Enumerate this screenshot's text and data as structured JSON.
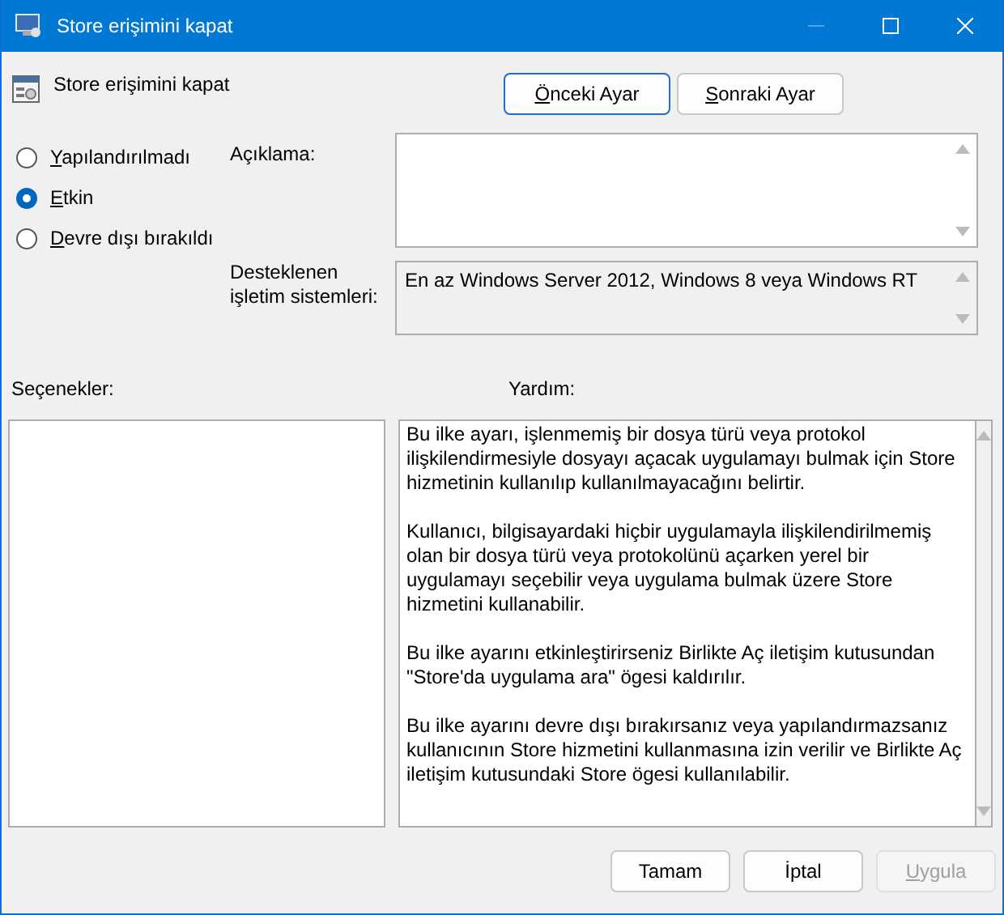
{
  "window": {
    "title": "Store erişimini kapat",
    "controls": [
      {
        "kind": "minimize",
        "disabled": true
      },
      {
        "kind": "maximize",
        "disabled": false
      },
      {
        "kind": "close",
        "disabled": false
      }
    ]
  },
  "header": {
    "title": "Store erişimini kapat"
  },
  "nav_buttons": [
    {
      "label": "Önceki Ayar",
      "underline_first": true,
      "focused": true
    },
    {
      "label": "Sonraki Ayar",
      "underline_first": true,
      "focused": false
    }
  ],
  "states": [
    {
      "label": "Yapılandırılmadı",
      "underline_first": true,
      "selected": false
    },
    {
      "label": "Etkin",
      "underline_first": true,
      "selected": true
    },
    {
      "label": "Devre dışı bırakıldı",
      "underline_first": true,
      "selected": false
    }
  ],
  "comment": {
    "label": "Açıklama:"
  },
  "supported": {
    "label": "Desteklenen işletim sistemleri:",
    "value": "En az Windows Server 2012, Windows 8 veya Windows RT"
  },
  "options": {
    "label": "Seçenekler:"
  },
  "help": {
    "label": "Yardım:",
    "paragraphs": [
      "Bu ilke ayarı, işlenmemiş bir dosya türü veya protokol ilişkilendirmesiyle dosyayı açacak uygulamayı bulmak için Store hizmetinin kullanılıp kullanılmayacağını belirtir.",
      "Kullanıcı, bilgisayardaki hiçbir uygulamayla ilişkilendirilmemiş olan bir dosya türü veya protokolünü açarken yerel bir uygulamayı seçebilir veya uygulama bulmak üzere Store hizmetini kullanabilir.",
      "Bu ilke ayarını etkinleştirirseniz Birlikte Aç iletişim kutusundan \"Store'da uygulama ara\" ögesi kaldırılır.",
      "Bu ilke ayarını devre dışı bırakırsanız veya yapılandırmazsanız kullanıcının Store hizmetini kullanmasına izin verilir ve Birlikte Aç iletişim kutusundaki Store ögesi kullanılabilir."
    ]
  },
  "footer_buttons": [
    {
      "label": "Tamam",
      "underline_first": false,
      "disabled": false
    },
    {
      "label": "İptal",
      "underline_first": false,
      "disabled": false
    },
    {
      "label": "Uygula",
      "underline_first": true,
      "disabled": true
    }
  ]
}
